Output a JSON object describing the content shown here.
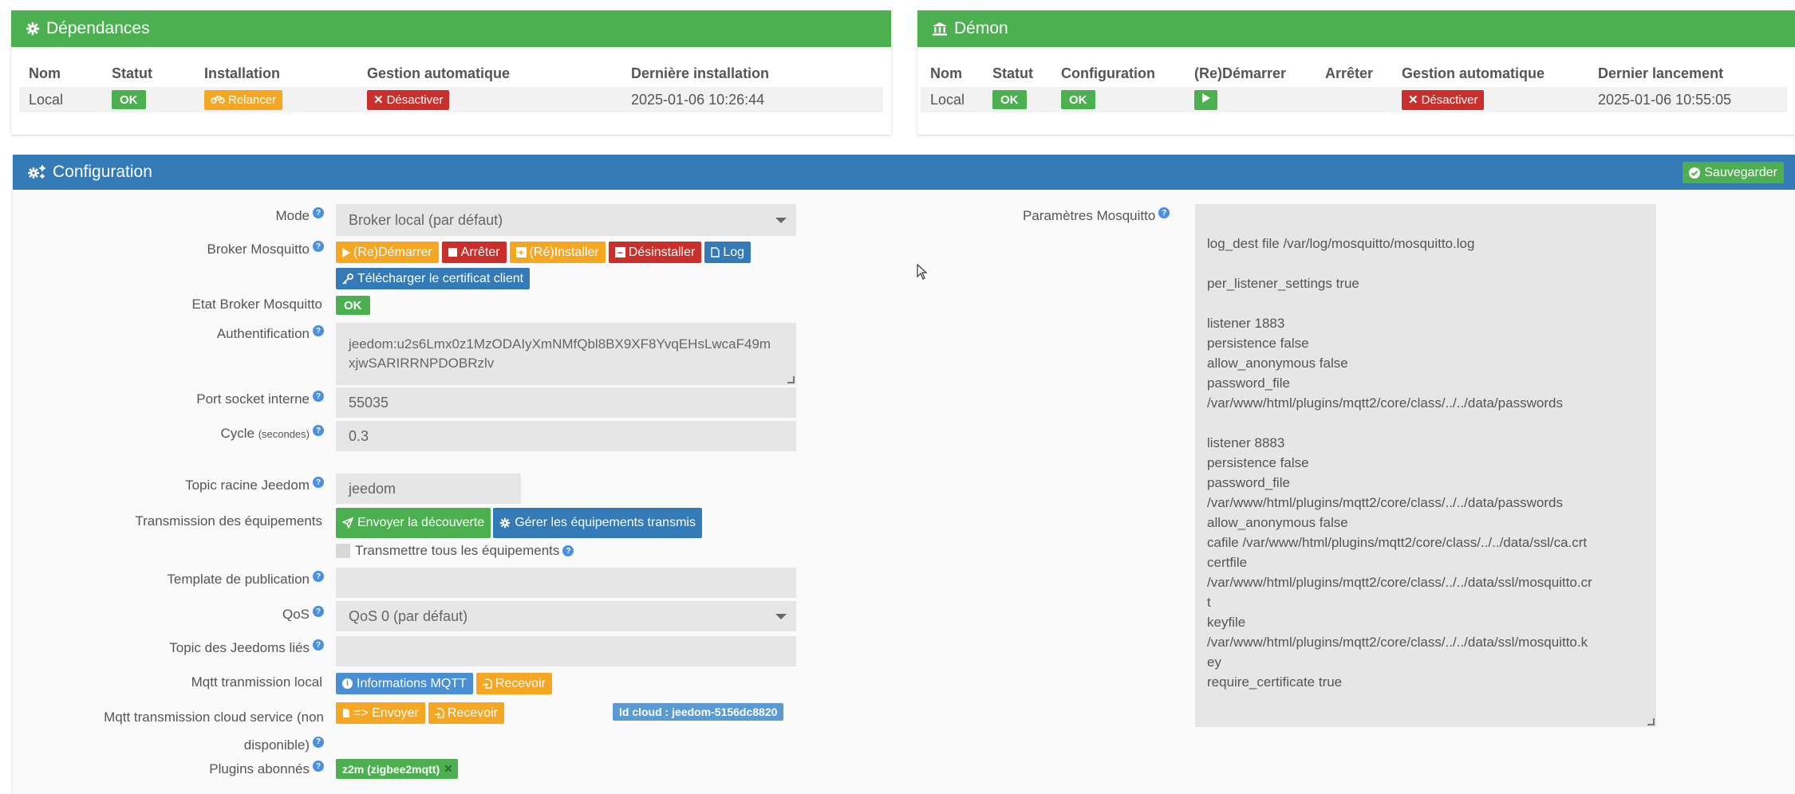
{
  "dependances": {
    "title": "Dépendances",
    "headers": [
      "Nom",
      "Statut",
      "Installation",
      "Gestion automatique",
      "Dernière installation"
    ],
    "row": {
      "nom": "Local",
      "statut": "OK",
      "installation": "Relancer",
      "gestion": "Désactiver",
      "derniere": "2025-01-06 10:26:44"
    }
  },
  "demon": {
    "title": "Démon",
    "headers": [
      "Nom",
      "Statut",
      "Configuration",
      "(Re)Démarrer",
      "Arrêter",
      "Gestion automatique",
      "Dernier lancement"
    ],
    "row": {
      "nom": "Local",
      "statut": "OK",
      "configuration": "OK",
      "gestion": "Désactiver",
      "dernier": "2025-01-06 10:55:05"
    }
  },
  "config": {
    "title": "Configuration",
    "save": "Sauvegarder",
    "labels": {
      "mode": "Mode",
      "broker": "Broker Mosquitto",
      "etat": "Etat Broker Mosquitto",
      "auth": "Authentification",
      "port": "Port socket interne",
      "cycle": "Cycle",
      "cycle_unit": "(secondes)",
      "topic": "Topic racine Jeedom",
      "transmission": "Transmission des équipements",
      "template": "Template de publication",
      "qos": "QoS",
      "linked": "Topic des Jeedoms liés",
      "local": "Mqtt tranmission local",
      "cloud1": "Mqtt transmission cloud service (non",
      "cloud2": "disponible)",
      "plugins": "Plugins abonnés",
      "params": "Paramètres Mosquitto"
    },
    "mode_value": "Broker local (par défaut)",
    "broker_buttons": {
      "restart": "(Re)Démarrer",
      "stop": "Arrêter",
      "reinstall": "(Ré)Installer",
      "uninstall": "Désinstaller",
      "log": "Log",
      "cert": "Télécharger le certificat client"
    },
    "etat_value": "OK",
    "auth_line1": "jeedom:u2s6Lmx0z1MzODAIyXmNMfQbl8BX9XF8YvqEHsLwcaF49m",
    "auth_line2": "xjwSARIRRNPDOBRzlv",
    "port_value": "55035",
    "cycle_value": "0.3",
    "topic_value": "jeedom",
    "transmission_buttons": {
      "send": "Envoyer la découverte",
      "manage": "Gérer les équipements transmis"
    },
    "transmit_all": "Transmettre tous les équipements",
    "qos_value": "QoS 0 (par défaut)",
    "local_buttons": {
      "info": "Informations MQTT",
      "receive": "Recevoir"
    },
    "cloud_buttons": {
      "send": "=> Envoyer",
      "receive": "Recevoir",
      "id": "Id cloud : jeedom-5156dc8820"
    },
    "plugin_tag": "z2m (zigbee2mqtt)",
    "mosquitto_lines": [
      "",
      "log_dest file /var/log/mosquitto/mosquitto.log",
      "",
      "per_listener_settings true",
      "",
      "listener 1883",
      "persistence false",
      "allow_anonymous false",
      "password_file",
      "/var/www/html/plugins/mqtt2/core/class/../../data/passwords",
      "",
      "listener 8883",
      "persistence false",
      "password_file",
      "/var/www/html/plugins/mqtt2/core/class/../../data/passwords",
      "allow_anonymous false",
      "cafile /var/www/html/plugins/mqtt2/core/class/../../data/ssl/ca.crt",
      "certfile",
      "/var/www/html/plugins/mqtt2/core/class/../../data/ssl/mosquitto.cr",
      "t",
      "keyfile",
      "/var/www/html/plugins/mqtt2/core/class/../../data/ssl/mosquitto.k",
      "ey",
      "require_certificate true"
    ]
  }
}
